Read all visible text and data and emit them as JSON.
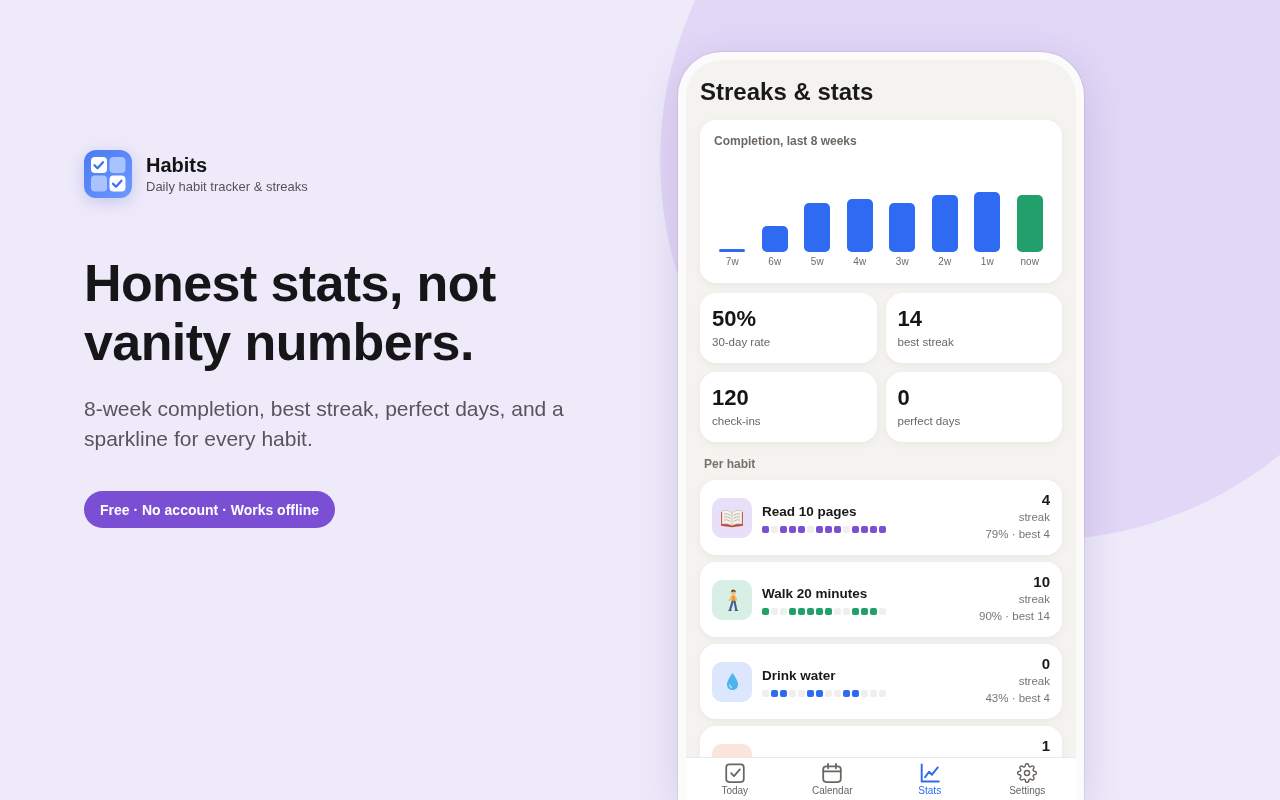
{
  "brand": {
    "name": "Habits",
    "tagline": "Daily habit tracker & streaks"
  },
  "hero": {
    "headline": "Honest stats, not vanity numbers.",
    "subheadline": "8-week completion, best streak, perfect days, and a sparkline for every habit.",
    "badge": "Free · No account · Works offline"
  },
  "phone": {
    "title": "Streaks & stats",
    "chart": {
      "title": "Completion, last 8 weeks",
      "bars": [
        {
          "label": "7w",
          "color": "#2f6bf2"
        },
        {
          "label": "6w",
          "color": "#2f6bf2"
        },
        {
          "label": "5w",
          "color": "#2f6bf2"
        },
        {
          "label": "4w",
          "color": "#2f6bf2"
        },
        {
          "label": "3w",
          "color": "#2f6bf2"
        },
        {
          "label": "2w",
          "color": "#2f6bf2"
        },
        {
          "label": "1w",
          "color": "#2f6bf2"
        },
        {
          "label": "now",
          "color": "#22a06b"
        }
      ]
    },
    "stats": [
      {
        "value": "50%",
        "label": "30-day rate"
      },
      {
        "value": "14",
        "label": "best streak"
      },
      {
        "value": "120",
        "label": "check-ins"
      },
      {
        "value": "0",
        "label": "perfect days"
      }
    ],
    "section_label": "Per habit",
    "habits": [
      {
        "name": "Read 10 pages",
        "tile": {
          "color": "#e8e0f8"
        },
        "color": "#7b4fd4",
        "days": [
          {
            "done": true
          },
          {
            "done": false
          },
          {
            "done": true
          },
          {
            "done": true
          },
          {
            "done": true
          },
          {
            "done": false
          },
          {
            "done": true
          },
          {
            "done": true
          },
          {
            "done": true
          },
          {
            "done": false
          },
          {
            "done": true
          },
          {
            "done": true
          },
          {
            "done": true
          },
          {
            "done": true
          }
        ],
        "streak": "4",
        "streak_label": "streak",
        "summary": "79% · best 4"
      },
      {
        "name": "Walk 20 minutes",
        "tile": {
          "color": "#d7efe4"
        },
        "color": "#22a06b",
        "days": [
          {
            "done": true
          },
          {
            "done": false
          },
          {
            "done": false
          },
          {
            "done": true
          },
          {
            "done": true
          },
          {
            "done": true
          },
          {
            "done": true
          },
          {
            "done": true
          },
          {
            "done": false
          },
          {
            "done": false
          },
          {
            "done": true
          },
          {
            "done": true
          },
          {
            "done": true
          },
          {
            "done": false
          }
        ],
        "streak": "10",
        "streak_label": "streak",
        "summary": "90% · best 14"
      },
      {
        "name": "Drink water",
        "tile": {
          "color": "#dce7fd"
        },
        "color": "#2f6bf2",
        "days": [
          {
            "done": false
          },
          {
            "done": true
          },
          {
            "done": true
          },
          {
            "done": false
          },
          {
            "done": false
          },
          {
            "done": true
          },
          {
            "done": true
          },
          {
            "done": false
          },
          {
            "done": false
          },
          {
            "done": true
          },
          {
            "done": true
          },
          {
            "done": false
          },
          {
            "done": false
          },
          {
            "done": false
          }
        ],
        "streak": "0",
        "streak_label": "streak",
        "summary": "43% · best 4"
      },
      {
        "tile": {
          "color": "#fbe4dc"
        },
        "streak": "1"
      }
    ],
    "nav": [
      {
        "label": "Today",
        "selected": false
      },
      {
        "label": "Calendar",
        "selected": false
      },
      {
        "label": "Stats",
        "selected": true
      },
      {
        "label": "Settings",
        "selected": false
      }
    ]
  }
}
